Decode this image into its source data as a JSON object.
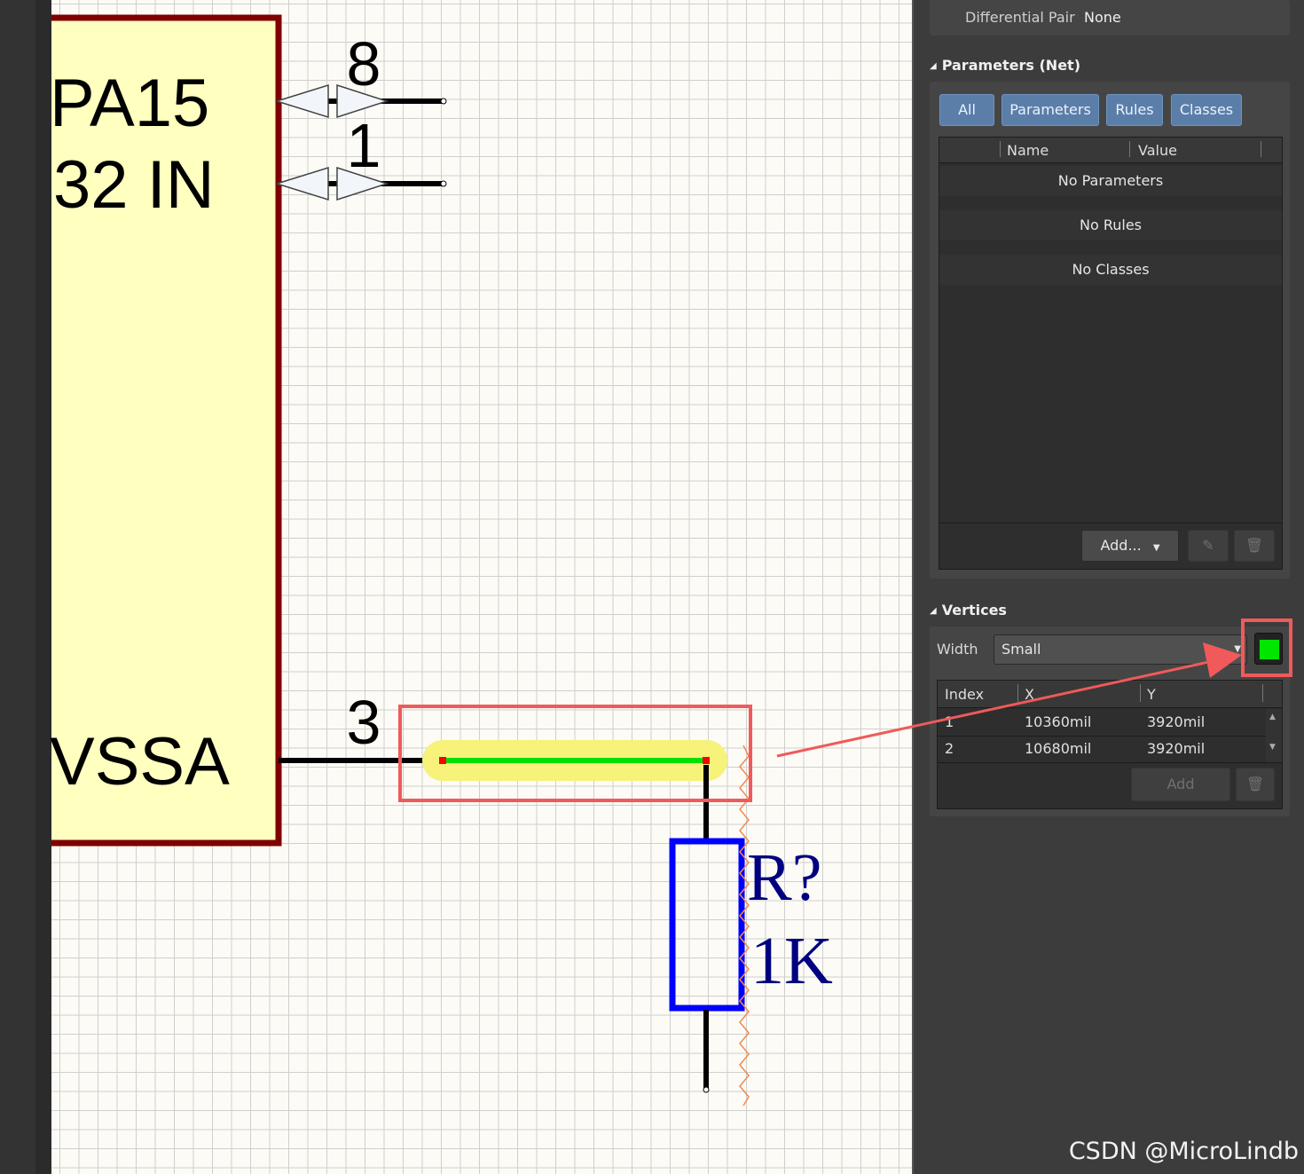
{
  "schematic": {
    "pin_labels": [
      "PA15",
      "32 IN",
      "VSSA"
    ],
    "pin_numbers": [
      "8",
      "1",
      "3"
    ],
    "resistor": {
      "designator": "R?",
      "value": "1K"
    }
  },
  "panel": {
    "differential_pair": {
      "label": "Differential Pair",
      "value": "None"
    },
    "parameters_section": {
      "title": "Parameters (Net)",
      "filters": [
        "All",
        "Parameters",
        "Rules",
        "Classes"
      ],
      "columns": [
        "Name",
        "Value"
      ],
      "messages": [
        "No Parameters",
        "No Rules",
        "No Classes"
      ],
      "add_label": "Add..."
    },
    "vertices_section": {
      "title": "Vertices",
      "width_label": "Width",
      "width_value": "Small",
      "color_swatch": "#00e600",
      "columns": [
        "Index",
        "X",
        "Y"
      ],
      "rows": [
        {
          "index": "1",
          "x": "10360mil",
          "y": "3920mil"
        },
        {
          "index": "2",
          "x": "10680mil",
          "y": "3920mil"
        }
      ],
      "add_label": "Add"
    }
  },
  "watermark": "CSDN @MicroLindb",
  "colors": {
    "highlight_box": "#f05a5a",
    "wire_selected": "#00e000",
    "wire_glow": "#f6f27a",
    "component_body": "#ffffc0",
    "component_border": "#800000",
    "resistor": "#0000ff",
    "resistor_text": "#000080"
  }
}
